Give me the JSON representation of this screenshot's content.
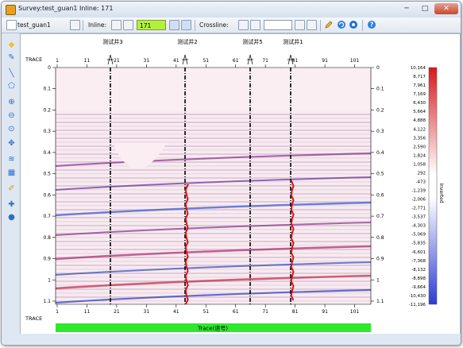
{
  "window": {
    "title": "Survey:test_guan1 Inline: 171",
    "minimize_label": "─",
    "maximize_label": "□",
    "close_label": "✕"
  },
  "toolbar": {
    "survey_name": "test_guan1",
    "inline_label": "Inline:",
    "inline_value": "171",
    "crossline_label": "Crossline:",
    "crossline_value": ""
  },
  "left_tools": [
    {
      "icon": "pointer-icon"
    },
    {
      "icon": "edit-icon"
    },
    {
      "icon": "line-draw-icon"
    },
    {
      "icon": "polygon-icon"
    },
    {
      "icon": "zoom-in-icon"
    },
    {
      "icon": "zoom-out-icon"
    },
    {
      "icon": "zoom-fit-icon"
    },
    {
      "icon": "pan-icon"
    },
    {
      "icon": "wiggle-icon"
    },
    {
      "icon": "grid-icon"
    },
    {
      "icon": "pick-icon"
    },
    {
      "icon": "crosshair-icon"
    },
    {
      "icon": "info-icon"
    }
  ],
  "section": {
    "trace_label": "TRACE",
    "trace_ticks": [
      "1",
      "11",
      "21",
      "31",
      "41",
      "51",
      "61",
      "71",
      "81",
      "91",
      "101"
    ],
    "time_ticks": [
      "0",
      "0.1",
      "0.2",
      "0.3",
      "0.4",
      "0.5",
      "0.6",
      "0.7",
      "0.8",
      "0.9",
      "1",
      "1.1"
    ],
    "axis_title": "Trace(道号)",
    "wells": [
      {
        "name": "测试井3"
      },
      {
        "name": "测试井2"
      },
      {
        "name": "测试井5"
      },
      {
        "name": "测试井1"
      }
    ]
  },
  "colorbar": {
    "label": "Inverted",
    "values": [
      "10,164",
      "8,717",
      "7,961",
      "7,169",
      "6,430",
      "5,664",
      "4,888",
      "4,122",
      "3,356",
      "2,590",
      "1,824",
      "1,058",
      "292",
      "-473",
      "-1,239",
      "-2,006",
      "-2,771",
      "-3,537",
      "-4,303",
      "-5,069",
      "-5,835",
      "-6,601",
      "-7,368",
      "-8,132",
      "-8,898",
      "-9,664",
      "-10,430",
      "-11,196"
    ],
    "colors": {
      "top": "#d7191c",
      "mid": "#ffffff",
      "bottom": "#2b3bd6"
    }
  },
  "colors": {
    "trace_bar": "#2ee82e",
    "well_log": "#dd1111",
    "accent": "#b5f03c"
  }
}
